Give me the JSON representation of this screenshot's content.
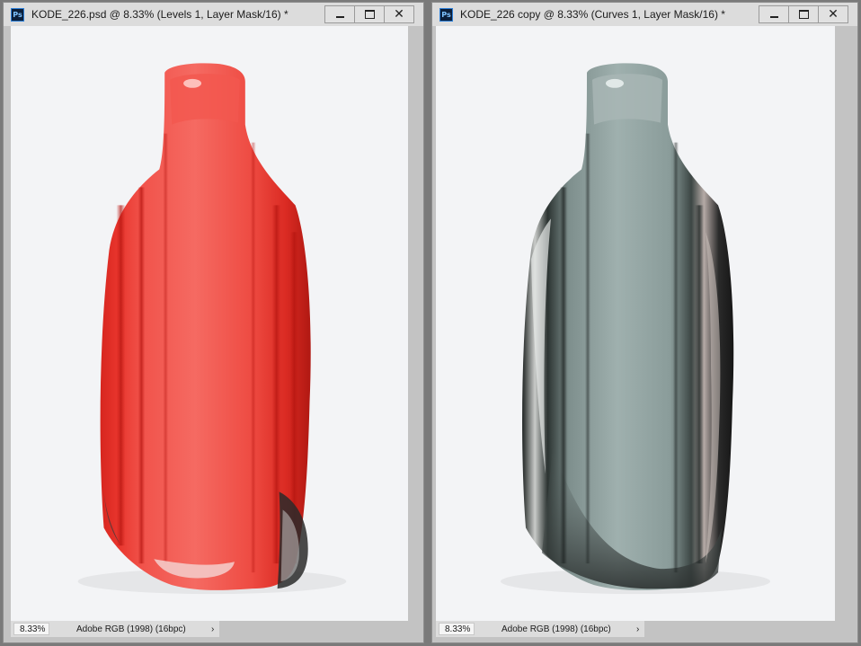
{
  "windows": [
    {
      "title": "KODE_226.psd @ 8.33% (Levels 1, Layer Mask/16) *",
      "app_icon": "Ps",
      "zoom": "8.33%",
      "profile": "Adobe RGB (1998) (16bpc)",
      "arrow": "›",
      "image": "red-masked-glass-bottle"
    },
    {
      "title": "KODE_226 copy @ 8.33% (Curves 1, Layer Mask/16) *",
      "app_icon": "Ps",
      "zoom": "8.33%",
      "profile": "Adobe RGB (1998) (16bpc)",
      "arrow": "›",
      "image": "grey-green-glass-bottle"
    }
  ],
  "colors": {
    "mask_overlay": "#ef3b35",
    "glass_tint": "#8fa3a1",
    "canvas_bg": "#f3f4f6",
    "workspace": "#7a7a7a"
  },
  "controls": {
    "minimize": "–",
    "maximize": "□",
    "close": "✕"
  }
}
